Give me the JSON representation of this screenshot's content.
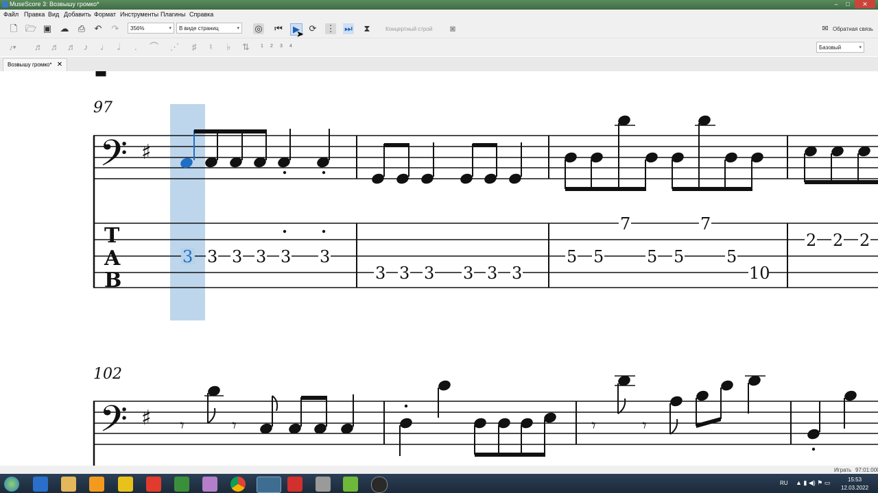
{
  "window": {
    "title": "MuseScore 3: Возвышу громко*"
  },
  "menu": [
    "Файл",
    "Правка",
    "Вид",
    "Добавить",
    "Формат",
    "Инструменты",
    "Плагины",
    "Справка"
  ],
  "toolbar": {
    "zoom": "356%",
    "view_mode": "В виде страниц",
    "concert_pitch": "Концертный строй",
    "feedback": "Обратная связь",
    "workspace": "Базовый",
    "voices": [
      "1",
      "2",
      "3",
      "4"
    ]
  },
  "tab": {
    "label": "Возвышу громко*"
  },
  "score": {
    "measure_numbers": [
      "97",
      "102"
    ],
    "tab_clef": [
      "T",
      "A",
      "B"
    ],
    "tab_system1": {
      "selected": "3",
      "m97": [
        "3",
        "3",
        "3",
        "3",
        "3"
      ],
      "m98": [
        "3",
        "3",
        "3",
        "3",
        "3",
        "3"
      ],
      "m99_string1": [
        "7",
        "7"
      ],
      "m99_string3": [
        "5",
        "5",
        "5",
        "5",
        "5"
      ],
      "m99_string4": [
        "10"
      ],
      "m100": [
        "2",
        "2",
        "2"
      ]
    }
  },
  "status": {
    "mode": "Играть",
    "position": "97:01:000"
  },
  "taskbar": {
    "lang": "RU",
    "time": "15:53",
    "date": "12.03.2022"
  }
}
